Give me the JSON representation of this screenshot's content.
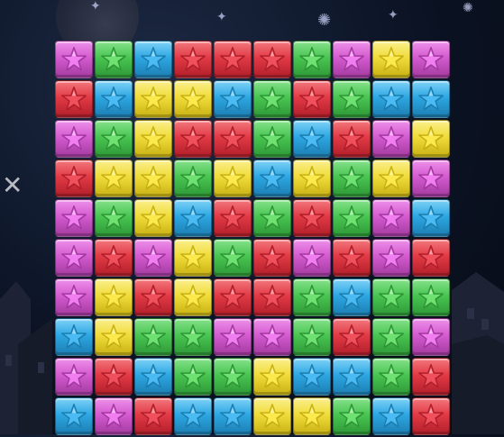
{
  "palette": {
    "purple": {
      "base": "#d45bd0",
      "light": "#ee90ea",
      "dark": "#a33a9f",
      "star": "#f07ef0"
    },
    "green": {
      "base": "#49c552",
      "light": "#86e28b",
      "dark": "#2e9836",
      "star": "#6fe072"
    },
    "blue": {
      "base": "#2da7e3",
      "light": "#7fd2f7",
      "dark": "#1c7eb1",
      "star": "#4bbcf3"
    },
    "red": {
      "base": "#e23a45",
      "light": "#f2787e",
      "dark": "#b11f2a",
      "star": "#f0505b"
    },
    "yellow": {
      "base": "#f0dc3a",
      "light": "#fbef8d",
      "dark": "#c9b214",
      "star": "#fbe94e"
    }
  },
  "board": {
    "rows": [
      [
        "purple",
        "green",
        "blue",
        "red",
        "red",
        "red",
        "green",
        "purple",
        "yellow",
        "purple"
      ],
      [
        "red",
        "blue",
        "yellow",
        "yellow",
        "blue",
        "green",
        "red",
        "green",
        "blue",
        "blue"
      ],
      [
        "purple",
        "green",
        "yellow",
        "red",
        "red",
        "green",
        "blue",
        "red",
        "purple",
        "yellow"
      ],
      [
        "red",
        "yellow",
        "yellow",
        "green",
        "yellow",
        "blue",
        "yellow",
        "green",
        "yellow",
        "purple"
      ],
      [
        "purple",
        "green",
        "yellow",
        "blue",
        "red",
        "green",
        "red",
        "green",
        "purple",
        "blue"
      ],
      [
        "purple",
        "red",
        "purple",
        "yellow",
        "green",
        "red",
        "purple",
        "red",
        "purple",
        "red"
      ],
      [
        "purple",
        "yellow",
        "red",
        "yellow",
        "red",
        "red",
        "green",
        "blue",
        "green",
        "green"
      ],
      [
        "blue",
        "yellow",
        "green",
        "green",
        "purple",
        "purple",
        "green",
        "red",
        "green",
        "purple"
      ],
      [
        "purple",
        "red",
        "blue",
        "green",
        "green",
        "yellow",
        "blue",
        "blue",
        "green",
        "red"
      ],
      [
        "blue",
        "purple",
        "red",
        "blue",
        "blue",
        "yellow",
        "yellow",
        "green",
        "blue",
        "red"
      ]
    ]
  },
  "decor": {
    "moon": "moon",
    "sparkles": [
      "sparkle",
      "sparkle",
      "sparkle",
      "sparkle",
      "sparkle",
      "sparkle"
    ],
    "skyline": "city-silhouette"
  }
}
